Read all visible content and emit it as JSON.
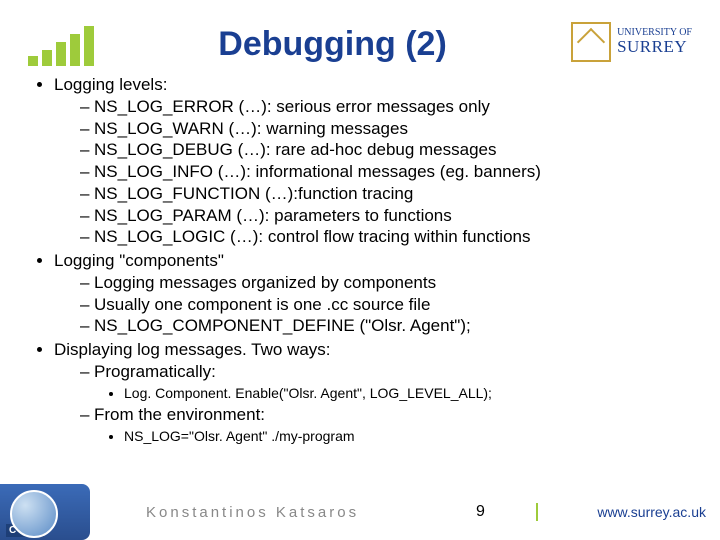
{
  "header": {
    "title": "Debugging (2)",
    "university_top": "UNIVERSITY OF",
    "university_name": "SURREY"
  },
  "bullets": {
    "b1": {
      "label": "Logging levels:"
    },
    "levels": {
      "i0": "NS_LOG_ERROR (…): serious error messages only",
      "i1": "NS_LOG_WARN (…): warning messages",
      "i2": "NS_LOG_DEBUG (…): rare ad-hoc debug messages",
      "i3": "NS_LOG_INFO (…): informational messages (eg. banners)",
      "i4": "NS_LOG_FUNCTION (…):function tracing",
      "i5": "NS_LOG_PARAM (…): parameters to functions",
      "i6": "NS_LOG_LOGIC (…): control flow tracing within functions"
    },
    "b2": {
      "label": "Logging \"components\""
    },
    "components": {
      "i0": "Logging messages organized by components",
      "i1": "Usually one component is one .cc source file",
      "i2": "NS_LOG_COMPONENT_DEFINE (\"Olsr. Agent\");"
    },
    "b3": {
      "label": "Displaying log messages. Two ways:"
    },
    "display": {
      "d0": {
        "label": "Programatically:",
        "sub": "Log. Component. Enable(\"Olsr. Agent\", LOG_LEVEL_ALL);"
      },
      "d1": {
        "label": "From the environment:",
        "sub": "NS_LOG=\"Olsr. Agent\" ./my-program"
      }
    }
  },
  "footer": {
    "badge": "CCSR",
    "author": "Konstantinos Katsaros",
    "page": "9",
    "url": "www.surrey.ac.uk"
  }
}
